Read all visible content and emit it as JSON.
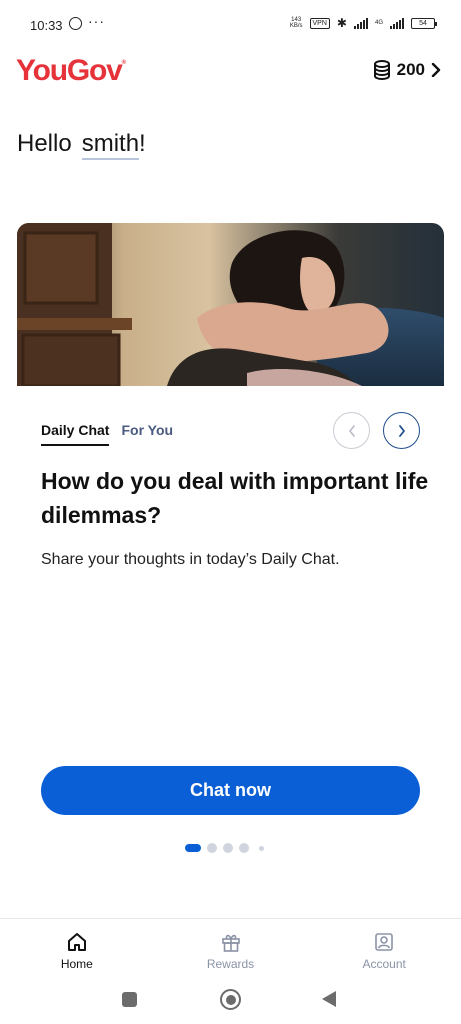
{
  "status_bar": {
    "time": "10:33",
    "more": "···",
    "net_speed_value": "143",
    "net_speed_unit": "KB/s",
    "vpn": "VPN",
    "network": "4G",
    "battery": "54"
  },
  "header": {
    "brand": "YouGov",
    "brand_mark": "®",
    "points": "200",
    "brand_color": "#e6333a"
  },
  "greeting": {
    "hello": "Hello",
    "name": "smith",
    "suffix": "!"
  },
  "card": {
    "tabs": [
      {
        "label": "Daily Chat",
        "active": true
      },
      {
        "label": "For You",
        "active": false
      }
    ],
    "headline": "How do you deal with important life dilemmas?",
    "subtext": "Share your thoughts in today’s Daily Chat.",
    "cta_label": "Chat now",
    "accent_color": "#0a5fd6"
  },
  "pagination": {
    "total": 5,
    "active_index": 0
  },
  "bottom_nav": {
    "items": [
      {
        "label": "Home",
        "icon": "home-icon",
        "active": true
      },
      {
        "label": "Rewards",
        "icon": "gift-icon",
        "active": false
      },
      {
        "label": "Account",
        "icon": "account-icon",
        "active": false
      }
    ]
  },
  "icons": {
    "points": "coins-icon",
    "prev": "chevron-left-icon",
    "next": "chevron-right-icon"
  }
}
